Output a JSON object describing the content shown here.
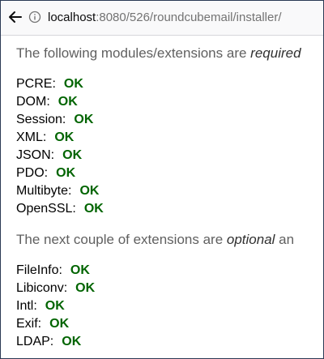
{
  "browser": {
    "url_host": "localhost",
    "url_rest": ":8080/526/roundcubemail/installer/"
  },
  "required": {
    "intro_before": "The following modules/extensions are ",
    "intro_emph": "required",
    "items": [
      {
        "name": "PCRE:",
        "status": "OK"
      },
      {
        "name": "DOM:",
        "status": "OK"
      },
      {
        "name": "Session:",
        "status": "OK"
      },
      {
        "name": "XML:",
        "status": "OK"
      },
      {
        "name": "JSON:",
        "status": "OK"
      },
      {
        "name": "PDO:",
        "status": "OK"
      },
      {
        "name": "Multibyte:",
        "status": "OK"
      },
      {
        "name": "OpenSSL:",
        "status": "OK"
      }
    ]
  },
  "optional": {
    "intro_before": "The next couple of extensions are ",
    "intro_emph": "optional",
    "intro_after": " an",
    "items": [
      {
        "name": "FileInfo:",
        "status": "OK"
      },
      {
        "name": "Libiconv:",
        "status": "OK"
      },
      {
        "name": "Intl:",
        "status": "OK"
      },
      {
        "name": "Exif:",
        "status": "OK"
      },
      {
        "name": "LDAP:",
        "status": "OK"
      }
    ]
  },
  "colors": {
    "ok": "#006400",
    "intro": "#606060"
  },
  "icons": {
    "back": "back-arrow-icon",
    "info": "info-icon"
  }
}
